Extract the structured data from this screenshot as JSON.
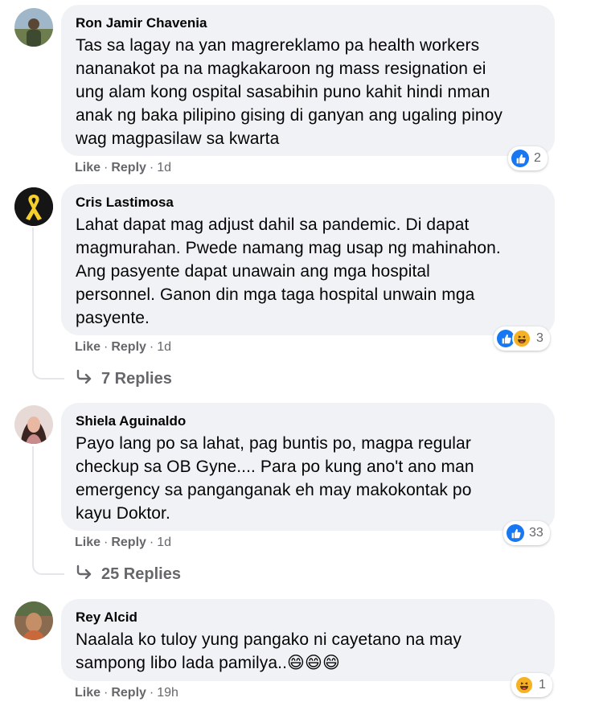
{
  "comments": [
    {
      "author": "Ron Jamir Chavenia",
      "text_lines": [
        "Tas sa lagay na yan magrereklamo pa health workers",
        "nananakot pa na magkakaroon ng mass resignation ei",
        "ung alam kong ospital sasabihin puno kahit hindi nman",
        "anak ng baka pilipino gising di ganyan ang ugaling pinoy",
        "wag magpasilaw sa kwarta"
      ],
      "like_label": "Like",
      "reply_label": "Reply",
      "time": "1d",
      "reaction_count": "2",
      "reactions": [
        "like-icon"
      ]
    },
    {
      "author": "Cris Lastimosa",
      "text_lines": [
        "Lahat dapat mag adjust dahil sa pandemic. Di dapat",
        "magmurahan. Pwede namang mag usap ng mahinahon.",
        "Ang pasyente dapat unawain ang mga hospital",
        "personnel. Ganon din mga taga hospital unwain mga",
        "pasyente."
      ],
      "like_label": "Like",
      "reply_label": "Reply",
      "time": "1d",
      "reaction_count": "3",
      "reactions": [
        "like-icon",
        "haha-icon"
      ],
      "replies_label": "7 Replies"
    },
    {
      "author": "Shiela Aguinaldo",
      "text_lines": [
        "Payo lang po sa lahat, pag buntis po, magpa regular",
        "checkup sa OB Gyne.... Para po kung ano't ano man",
        "emergency sa panganganak eh may makokontak po",
        "kayu Doktor."
      ],
      "like_label": "Like",
      "reply_label": "Reply",
      "time": "1d",
      "reaction_count": "33",
      "reactions": [
        "like-icon"
      ],
      "replies_label": "25 Replies"
    },
    {
      "author": "Rey Alcid",
      "text_lines": [
        "Naalala ko tuloy yung pangako ni cayetano na may",
        "sampong libo lada pamilya..😄😄😄"
      ],
      "like_label": "Like",
      "reply_label": "Reply",
      "time": "19h",
      "reaction_count": "1",
      "reactions": [
        "haha-icon"
      ]
    }
  ],
  "colors": {
    "bubble": "#f0f2f5",
    "meta": "#65676b",
    "like_blue": "#1877f2",
    "haha_yellow": "#f7b125"
  }
}
